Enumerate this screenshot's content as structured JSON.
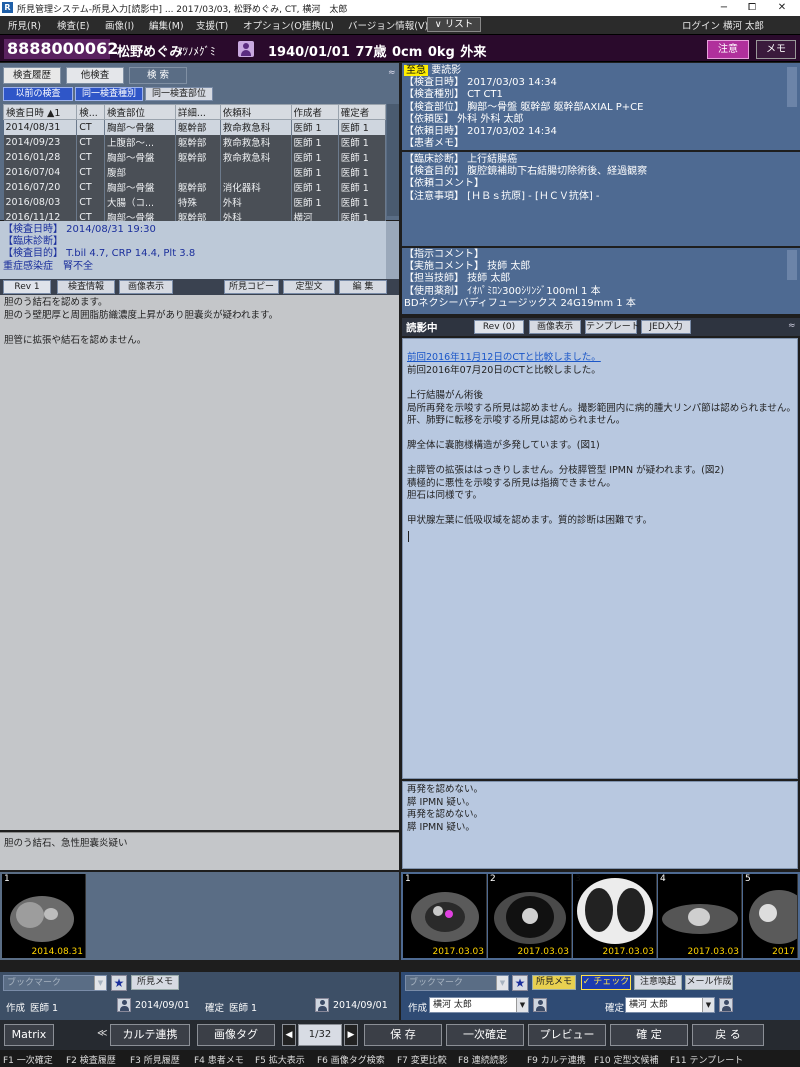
{
  "window": {
    "title": "所見管理システム-所見入力[読影中] ... 2017/03/03, 松野めぐみ, CT, 横河　太郎",
    "min": "−",
    "max": "⧠",
    "close": "✕"
  },
  "menu": {
    "items": [
      "所見(R)",
      "検査(E)",
      "画像(I)",
      "編集(M)",
      "支援(T)",
      "オプション(O)",
      "連携(L)",
      "バージョン情報(V)"
    ],
    "list_btn": "∨ リスト",
    "login": "ログイン 横河 太郎"
  },
  "patient": {
    "id": "8888000062",
    "name": "松野めぐみ",
    "kana": "ﾏﾂﾉﾒｸﾞﾐ",
    "info": "1940/01/01 77歳 0cm 0kg 外来",
    "attention": "注意",
    "memo": "メモ"
  },
  "left": {
    "tabs": [
      "検査履歴",
      "他検査",
      "検 索"
    ],
    "filters": [
      "以前の検査",
      "同一検査種別",
      "同一検査部位"
    ],
    "columns": [
      "検査日時 ▲1",
      "検...",
      "検査部位",
      "詳細...",
      "依頼科",
      "作成者",
      "確定者"
    ],
    "rows": [
      [
        "2014/08/31",
        "CT",
        "胸部～骨盤",
        "躯幹部",
        "救命救急科",
        "医師 1",
        "医師 1"
      ],
      [
        "2014/09/23",
        "CT",
        "上腹部～...",
        "躯幹部",
        "救命救急科",
        "医師 1",
        "医師 1"
      ],
      [
        "2016/01/28",
        "CT",
        "胸部～骨盤",
        "躯幹部",
        "救命救急科",
        "医師 1",
        "医師 1"
      ],
      [
        "2016/07/04",
        "CT",
        "腹部",
        "",
        "",
        "医師 1",
        "医師 1"
      ],
      [
        "2016/07/20",
        "CT",
        "胸部～骨盤",
        "躯幹部",
        "消化器科",
        "医師 1",
        "医師 1"
      ],
      [
        "2016/08/03",
        "CT",
        "大腸（コ...",
        "特殊",
        "外科",
        "医師 1",
        "医師 1"
      ],
      [
        "2016/11/12",
        "CT",
        "胸部～骨盤",
        "躯幹部",
        "外科",
        "横河",
        "医師 1"
      ]
    ],
    "detail": [
      "【検査日時】 2014/08/31 19:30",
      "【臨床診断】",
      "【検査目的】 T.bil 4.7, CRP 14.4, Plt 3.8",
      "重症感染症　腎不全"
    ],
    "toolbar": {
      "rev": "Rev 1",
      "exam_info": "検査情報",
      "image_show": "画像表示",
      "copy": "所見コピー",
      "template": "定型文",
      "edit": "編 集"
    },
    "report": "胆のう結石を認めます。\n胆のう壁肥厚と周囲脂肪織濃度上昇があり胆嚢炎が疑われます。\n\n胆管に拡張や結石を認めません。",
    "diagnosis": "胆のう結石、急性胆嚢炎疑い",
    "thumb": {
      "num": "1",
      "date": "2014.08.31"
    },
    "bookmark": {
      "placeholder": "ブックマーク",
      "star": "★",
      "memo": "所見メモ"
    },
    "footer": {
      "author_label": "作成",
      "author": "医師 1",
      "author_date": "2014/09/01",
      "confirm_label": "確定",
      "confirmer": "医師 1",
      "confirm_date": "2014/09/01"
    }
  },
  "right": {
    "order": {
      "urgent": "至急",
      "urgent_text": "要読影",
      "lines": [
        "【検査日時】 2017/03/03 14:34",
        "【検査種別】 CT CT1",
        "【検査部位】 胸部～骨盤 躯幹部 躯幹部AXIAL P+CE",
        "【依頼医】 外科 外科 太郎",
        "【依頼日時】 2017/03/02 14:34",
        "【患者メモ】"
      ]
    },
    "clinical": [
      "【臨床診断】 上行結腸癌",
      "【検査目的】 腹腔鏡補助下右結腸切除術後、経過観察",
      "【依頼コメント】",
      "【注意事項】 [ＨＢｓ抗原] - [ＨＣＶ抗体] -"
    ],
    "exec": [
      "【指示コメント】",
      "【実施コメント】 技師 太郎",
      "【担当技師】 技師 太郎",
      "【使用薬剤】 ｲｵﾊﾟﾐﾛﾝ300ｼﾘﾝｼﾞ100ml 1 本",
      "BDネクシーバディフュージックス 24G19mm 1 本"
    ],
    "toolbar": {
      "status": "読影中",
      "rev": "Rev (0)",
      "image_show": "画像表示",
      "template": "テンプレート",
      "jed": "JED入力"
    },
    "report_link": "前回2016年11月12日のCTと比較しました。",
    "report": "前回2016年07月20日のCTと比較しました。\n\n上行結腸がん術後\n局所再発を示唆する所見は認めません。撮影範囲内に病的腫大リンパ節は認められません。\n肝、肺野に転移を示唆する所見は認められません。\n\n脾全体に嚢胞様構造が多発しています。(図1)\n\n主膵管の拡張ははっきりしません。分枝膵管型 IPMN が疑われます。(図2)\n積極的に悪性を示唆する所見は指摘できません。\n胆石は同様です。\n\n甲状腺左葉に低吸収域を認めます。質的診断は困難です。",
    "impression": "再発を認めない。\n膵 IPMN 疑い。\n再発を認めない。\n膵 IPMN 疑い。",
    "thumbs": [
      {
        "num": "1",
        "date": "2017.03.03"
      },
      {
        "num": "2",
        "date": "2017.03.03"
      },
      {
        "num": "3",
        "date": "2017.03.03"
      },
      {
        "num": "4",
        "date": "2017.03.03"
      },
      {
        "num": "5",
        "date": "2017"
      }
    ],
    "bookmark": {
      "placeholder": "ブックマーク",
      "star": "★",
      "memo": "所見メモ",
      "check": "✓ チェック",
      "attn": "注意喚起",
      "mail": "メール作成"
    },
    "footer": {
      "author_label": "作成",
      "author": "横河 太郎",
      "confirm_label": "確定",
      "confirmer": "横河 太郎"
    }
  },
  "bottom": {
    "matrix": "Matrix",
    "expand": "≪",
    "karte": "カルテ連携",
    "image_tag": "画像タグ",
    "prev": "◀",
    "page": "1/32",
    "next": "▶",
    "save": "保 存",
    "first_confirm": "一次確定",
    "preview": "プレビュー",
    "confirm": "確 定",
    "back": "戻 る"
  },
  "fkeys": [
    "F1 一次確定",
    "F2 検査履歴",
    "F3 所見履歴",
    "F4 患者メモ",
    "F5 拡大表示",
    "F6 画像タグ検索",
    "F7 変更比較",
    "F8 連続読影",
    "F9 カルテ連携",
    "F10 定型文候補",
    "F11 テンプレート"
  ]
}
